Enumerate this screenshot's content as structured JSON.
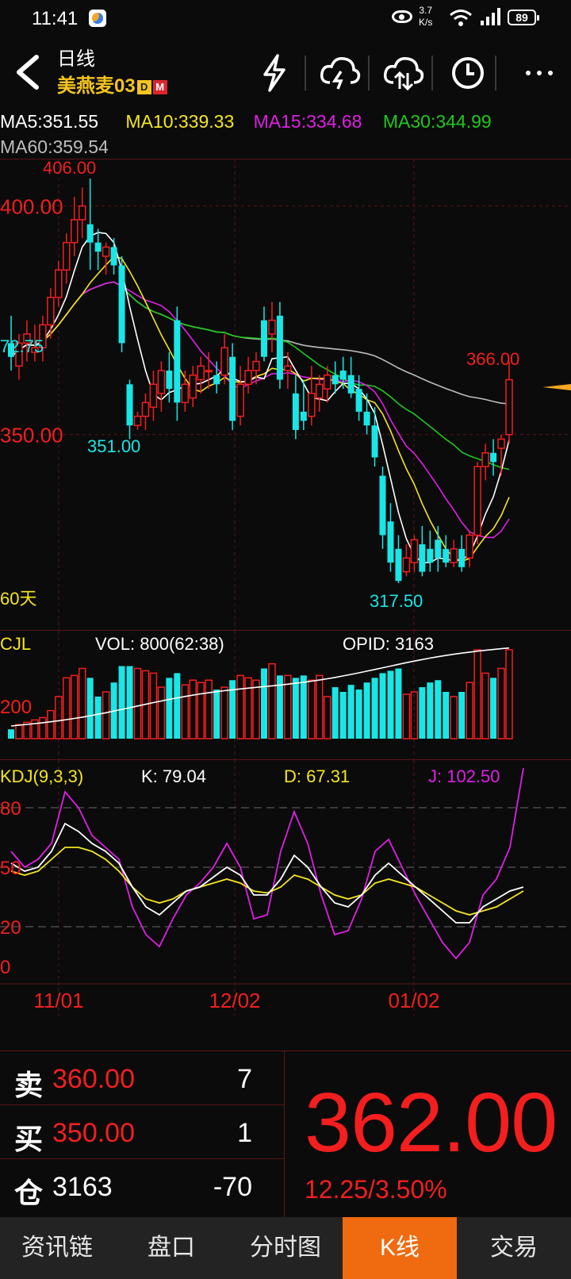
{
  "status": {
    "time": "11:41",
    "net_speed": "3.7",
    "net_unit": "K/s",
    "battery": "89"
  },
  "header": {
    "title": "日线",
    "symbol": "美燕麦03",
    "badge_d": "D",
    "badge_m": "M"
  },
  "ma": {
    "ma5": "MA5:351.55",
    "ma10": "MA10:339.33",
    "ma15": "MA15:334.68",
    "ma30": "MA30:344.99",
    "ma60": "MA60:359.54"
  },
  "colors": {
    "up": "#f31e1e",
    "down": "#19e6e6",
    "ma5": "#ffffff",
    "ma10": "#f5e61e",
    "ma15": "#e01ee6",
    "ma30": "#1ec81e",
    "ma60": "#bdbdbd"
  },
  "price_panel": {
    "label_400": "400.00",
    "label_350": "350.00",
    "label_high": "406.00",
    "label_low": "317.50",
    "label_351": "351.00",
    "label_left": "72.75",
    "label_last_high": "366.00",
    "period": "60天"
  },
  "vol_panel": {
    "title": "CJL",
    "vol": "VOL: 800(62:38)",
    "opid": "OPID: 3163",
    "axis_200": "200"
  },
  "kdj_panel": {
    "title": "KDJ(9,3,3)",
    "k": "K: 79.04",
    "d": "D: 67.31",
    "j": "J: 102.50",
    "axis_80": "80",
    "axis_50": "50",
    "axis_20": "20",
    "axis_0": "0"
  },
  "dates": [
    "11/01",
    "12/02",
    "01/02"
  ],
  "quote": {
    "sell_label": "卖",
    "sell_price": "360.00",
    "sell_qty": "7",
    "buy_label": "买",
    "buy_price": "350.00",
    "buy_qty": "1",
    "oi_label": "仓",
    "oi_value": "3163",
    "oi_change": "-70",
    "last": "362.00",
    "change": "12.25/3.50%"
  },
  "tabs": [
    "资讯链",
    "盘口",
    "分时图",
    "K线",
    "交易"
  ],
  "chart_data": {
    "type": "candlestick",
    "price_range": [
      317.5,
      406.0
    ],
    "candles": [
      {
        "o": 370,
        "h": 376,
        "l": 364,
        "c": 367
      },
      {
        "o": 365,
        "h": 372,
        "l": 362,
        "c": 370
      },
      {
        "o": 370,
        "h": 375,
        "l": 366,
        "c": 372
      },
      {
        "o": 368,
        "h": 374,
        "l": 366,
        "c": 369
      },
      {
        "o": 369,
        "h": 376,
        "l": 366,
        "c": 374
      },
      {
        "o": 374,
        "h": 382,
        "l": 371,
        "c": 380
      },
      {
        "o": 380,
        "h": 388,
        "l": 378,
        "c": 386
      },
      {
        "o": 386,
        "h": 394,
        "l": 383,
        "c": 392
      },
      {
        "o": 392,
        "h": 402,
        "l": 389,
        "c": 397
      },
      {
        "o": 397,
        "h": 404,
        "l": 393,
        "c": 400
      },
      {
        "o": 396,
        "h": 406,
        "l": 386,
        "c": 392
      },
      {
        "o": 392,
        "h": 395,
        "l": 386,
        "c": 390
      },
      {
        "o": 389,
        "h": 392,
        "l": 385,
        "c": 391
      },
      {
        "o": 391,
        "h": 393,
        "l": 385,
        "c": 387
      },
      {
        "o": 387,
        "h": 389,
        "l": 368,
        "c": 370
      },
      {
        "o": 361,
        "h": 362,
        "l": 349,
        "c": 352
      },
      {
        "o": 352,
        "h": 355,
        "l": 351,
        "c": 354
      },
      {
        "o": 354,
        "h": 359,
        "l": 351,
        "c": 357
      },
      {
        "o": 356,
        "h": 364,
        "l": 353,
        "c": 361
      },
      {
        "o": 359,
        "h": 366,
        "l": 355,
        "c": 364
      },
      {
        "o": 364,
        "h": 368,
        "l": 357,
        "c": 360
      },
      {
        "o": 375,
        "h": 378,
        "l": 353,
        "c": 357
      },
      {
        "o": 357,
        "h": 364,
        "l": 355,
        "c": 361
      },
      {
        "o": 358,
        "h": 365,
        "l": 356,
        "c": 363
      },
      {
        "o": 362,
        "h": 367,
        "l": 359,
        "c": 365
      },
      {
        "o": 364,
        "h": 368,
        "l": 360,
        "c": 364
      },
      {
        "o": 363,
        "h": 366,
        "l": 359,
        "c": 361
      },
      {
        "o": 363,
        "h": 372,
        "l": 361,
        "c": 369
      },
      {
        "o": 367,
        "h": 370,
        "l": 351,
        "c": 353
      },
      {
        "o": 354,
        "h": 365,
        "l": 352,
        "c": 361
      },
      {
        "o": 361,
        "h": 367,
        "l": 359,
        "c": 364
      },
      {
        "o": 364,
        "h": 368,
        "l": 361,
        "c": 366
      },
      {
        "o": 375,
        "h": 378,
        "l": 366,
        "c": 367
      },
      {
        "o": 372,
        "h": 379,
        "l": 368,
        "c": 375
      },
      {
        "o": 376,
        "h": 379,
        "l": 360,
        "c": 362
      },
      {
        "o": 364,
        "h": 368,
        "l": 360,
        "c": 365
      },
      {
        "o": 359,
        "h": 363,
        "l": 349,
        "c": 351
      },
      {
        "o": 355,
        "h": 362,
        "l": 351,
        "c": 353
      },
      {
        "o": 354,
        "h": 365,
        "l": 352,
        "c": 359
      },
      {
        "o": 358,
        "h": 363,
        "l": 355,
        "c": 361
      },
      {
        "o": 360,
        "h": 365,
        "l": 357,
        "c": 363
      },
      {
        "o": 363,
        "h": 366,
        "l": 359,
        "c": 361
      },
      {
        "o": 364,
        "h": 367,
        "l": 360,
        "c": 362
      },
      {
        "o": 363,
        "h": 367,
        "l": 358,
        "c": 359
      },
      {
        "o": 360,
        "h": 363,
        "l": 353,
        "c": 355
      },
      {
        "o": 355,
        "h": 359,
        "l": 350,
        "c": 352
      },
      {
        "o": 352,
        "h": 356,
        "l": 343,
        "c": 345
      },
      {
        "o": 341,
        "h": 343,
        "l": 325,
        "c": 328
      },
      {
        "o": 331,
        "h": 335,
        "l": 320,
        "c": 322
      },
      {
        "o": 325,
        "h": 328,
        "l": 317.5,
        "c": 318
      },
      {
        "o": 320,
        "h": 326,
        "l": 319,
        "c": 323
      },
      {
        "o": 322,
        "h": 328,
        "l": 320,
        "c": 327
      },
      {
        "o": 326,
        "h": 330,
        "l": 319,
        "c": 320
      },
      {
        "o": 325,
        "h": 329,
        "l": 320,
        "c": 322
      },
      {
        "o": 327,
        "h": 330,
        "l": 320,
        "c": 323
      },
      {
        "o": 325,
        "h": 328,
        "l": 321,
        "c": 322
      },
      {
        "o": 322,
        "h": 327,
        "l": 321,
        "c": 325
      },
      {
        "o": 325,
        "h": 328,
        "l": 320,
        "c": 321
      },
      {
        "o": 323,
        "h": 329,
        "l": 321,
        "c": 328
      },
      {
        "o": 328,
        "h": 344,
        "l": 326,
        "c": 343
      },
      {
        "o": 343,
        "h": 348,
        "l": 340,
        "c": 346
      },
      {
        "o": 346,
        "h": 349,
        "l": 341,
        "c": 344
      },
      {
        "o": 347,
        "h": 350,
        "l": 341,
        "c": 349
      },
      {
        "o": 350,
        "h": 366,
        "l": 348,
        "c": 362
      }
    ],
    "volume": [
      40,
      60,
      70,
      80,
      90,
      120,
      180,
      260,
      270,
      300,
      260,
      180,
      200,
      240,
      310,
      310,
      300,
      290,
      280,
      220,
      260,
      280,
      230,
      250,
      240,
      250,
      210,
      220,
      250,
      270,
      260,
      250,
      300,
      320,
      270,
      270,
      260,
      270,
      250,
      270,
      180,
      220,
      200,
      230,
      210,
      240,
      260,
      280,
      290,
      300,
      190,
      200,
      220,
      240,
      250,
      200,
      180,
      200,
      240,
      380,
      280,
      260,
      300,
      380
    ],
    "kdj_k": [
      52,
      48,
      50,
      58,
      72,
      68,
      62,
      58,
      52,
      40,
      30,
      26,
      32,
      38,
      40,
      45,
      50,
      46,
      36,
      36,
      44,
      56,
      50,
      40,
      32,
      30,
      36,
      46,
      52,
      46,
      40,
      34,
      28,
      22,
      22,
      30,
      34,
      38,
      40
    ],
    "kdj_d": [
      48,
      46,
      48,
      54,
      60,
      60,
      58,
      54,
      48,
      40,
      34,
      32,
      34,
      38,
      40,
      42,
      44,
      42,
      38,
      37,
      40,
      46,
      44,
      40,
      36,
      34,
      36,
      42,
      44,
      42,
      40,
      36,
      32,
      28,
      26,
      28,
      30,
      34,
      38
    ],
    "kdj_j": [
      58,
      50,
      54,
      62,
      88,
      80,
      66,
      60,
      54,
      30,
      16,
      10,
      24,
      36,
      42,
      50,
      62,
      50,
      24,
      26,
      58,
      78,
      62,
      36,
      16,
      18,
      34,
      58,
      64,
      50,
      36,
      24,
      12,
      4,
      12,
      36,
      44,
      60,
      100
    ]
  }
}
